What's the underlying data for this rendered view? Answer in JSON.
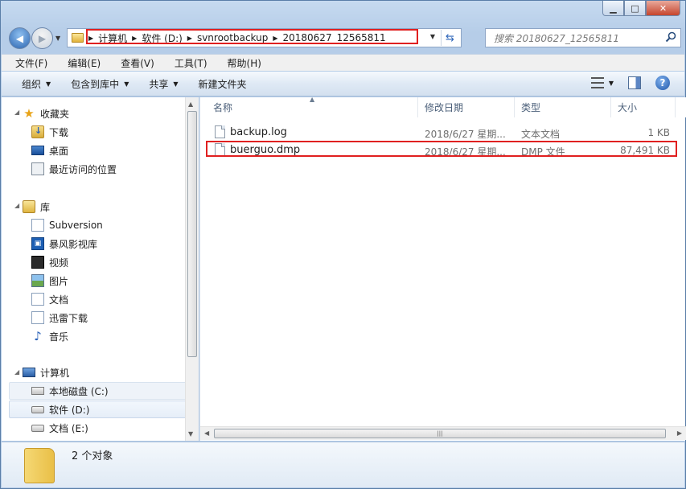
{
  "window": {
    "caption": {
      "minimize": "▁",
      "maximize": "□",
      "close": "✕"
    }
  },
  "address": {
    "crumbs": [
      "计算机",
      "软件 (D:)",
      "svnrootbackup",
      "20180627_12565811"
    ],
    "search_placeholder": "搜索 20180627_12565811"
  },
  "menu": [
    "文件(F)",
    "编辑(E)",
    "查看(V)",
    "工具(T)",
    "帮助(H)"
  ],
  "commands": [
    "组织",
    "包含到库中",
    "共享",
    "新建文件夹"
  ],
  "nav": {
    "favorites": {
      "label": "收藏夹",
      "items": [
        "下载",
        "桌面",
        "最近访问的位置"
      ]
    },
    "libraries": {
      "label": "库",
      "items": [
        "Subversion",
        "暴风影视库",
        "视频",
        "图片",
        "文档",
        "迅雷下载",
        "音乐"
      ]
    },
    "computer": {
      "label": "计算机",
      "items": [
        "本地磁盘 (C:)",
        "软件 (D:)",
        "文档 (E:)"
      ]
    }
  },
  "columns": {
    "name": "名称",
    "date": "修改日期",
    "type": "类型",
    "size": "大小"
  },
  "files": [
    {
      "name": "backup.log",
      "date": "2018/6/27 星期...",
      "type": "文本文档",
      "size": "1 KB"
    },
    {
      "name": "buerguo.dmp",
      "date": "2018/6/27 星期...",
      "type": "DMP 文件",
      "size": "87,491 KB"
    }
  ],
  "details": {
    "count": "2 个对象"
  },
  "colors": {
    "highlight": "#e02020",
    "accent": "#2a62b8"
  }
}
